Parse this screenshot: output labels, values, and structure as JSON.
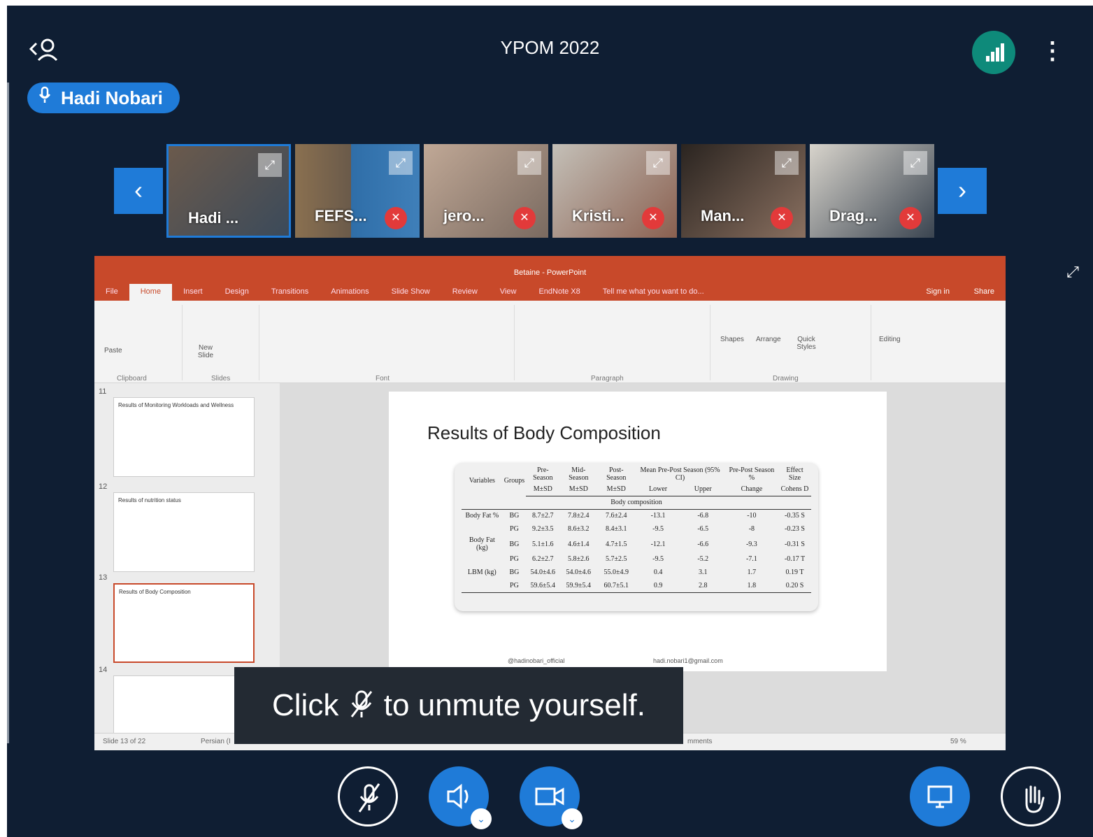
{
  "header": {
    "title": "YPOM 2022",
    "user_icon": "user-back-icon",
    "signal_icon": "signal-bars-icon",
    "menu_icon": "kebab-menu-icon"
  },
  "speaker": {
    "name": "Hadi Nobari",
    "icon": "microphone-icon"
  },
  "participants": [
    {
      "name": "Hadi ...",
      "muted": false
    },
    {
      "name": "FEFS...",
      "muted": true
    },
    {
      "name": "jero...",
      "muted": true
    },
    {
      "name": "Kristi...",
      "muted": true
    },
    {
      "name": "Man...",
      "muted": true
    },
    {
      "name": "Drag...",
      "muted": true
    }
  ],
  "nav": {
    "prev": "‹",
    "next": "›"
  },
  "powerpoint": {
    "window_title": "Betaine - PowerPoint",
    "tabs": [
      "File",
      "Home",
      "Insert",
      "Design",
      "Transitions",
      "Animations",
      "Slide Show",
      "Review",
      "View",
      "EndNote X8"
    ],
    "tell_me": "Tell me what you want to do...",
    "sign_in": "Sign in",
    "share": "Share",
    "ribbon": {
      "paste": "Paste",
      "new_slide": "New Slide",
      "shapes": "Shapes",
      "arrange": "Arrange",
      "quick_styles": "Quick Styles",
      "editing": "Editing",
      "groups": [
        "Clipboard",
        "Slides",
        "Font",
        "Paragraph",
        "Drawing"
      ]
    },
    "slides": [
      {
        "num": "11",
        "title": "Results of Monitoring Workloads and Wellness"
      },
      {
        "num": "12",
        "title": "Results of nutrition status"
      },
      {
        "num": "13",
        "title": "Results of Body Composition"
      },
      {
        "num": "14",
        "title": ""
      }
    ],
    "current_slide": {
      "title": "Results of Body Composition",
      "table": {
        "header_row1": [
          "Variables",
          "Groups",
          "Pre-Season",
          "Mid- Season",
          "Post- Season",
          "Mean Pre-Post Season (95% CI)",
          "Pre-Post Season %",
          "Effect Size"
        ],
        "header_row2": [
          "",
          "",
          "M±SD",
          "M±SD",
          "M±SD",
          "Lower",
          "Upper",
          "Change",
          "Cohens D"
        ],
        "section": "Body composition",
        "rows": [
          [
            "Body Fat %",
            "BG",
            "8.7±2.7",
            "7.8±2.4",
            "7.6±2.4",
            "-13.1",
            "-6.8",
            "-10",
            "-0.35 S"
          ],
          [
            "",
            "PG",
            "9.2±3.5",
            "8.6±3.2",
            "8.4±3.1",
            "-9.5",
            "-6.5",
            "-8",
            "-0.23 S"
          ],
          [
            "Body Fat (kg)",
            "BG",
            "5.1±1.6",
            "4.6±1.4",
            "4.7±1.5",
            "-12.1",
            "-6.6",
            "-9.3",
            "-0.31 S"
          ],
          [
            "",
            "PG",
            "6.2±2.7",
            "5.8±2.6",
            "5.7±2.5",
            "-9.5",
            "-5.2",
            "-7.1",
            "-0.17 T"
          ],
          [
            "LBM (kg)",
            "BG",
            "54.0±4.6",
            "54.0±4.6",
            "55.0±4.9",
            "0.4",
            "3.1",
            "1.7",
            "0.19 T"
          ],
          [
            "",
            "PG",
            "59.6±5.4",
            "59.9±5.4",
            "60.7±5.1",
            "0.9",
            "2.8",
            "1.8",
            "0.20 S"
          ]
        ]
      },
      "footer_instagram": "@hadinobari_official",
      "footer_email": "hadi.nobari1@gmail.com"
    },
    "status_bar": {
      "slide_of": "Slide 13 of 22",
      "language": "Persian (I",
      "comments": "mments",
      "zoom": "59 %"
    }
  },
  "toast": {
    "prefix": "Click",
    "icon": "muted-microphone-icon",
    "suffix": "to unmute yourself."
  },
  "controls": {
    "mic": "muted-microphone-icon",
    "speaker": "speaker-icon",
    "camera": "video-camera-icon",
    "screen": "screen-share-icon",
    "hand": "raise-hand-icon"
  }
}
